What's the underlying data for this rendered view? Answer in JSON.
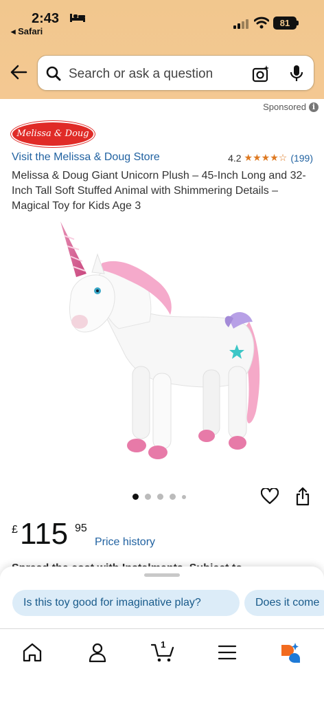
{
  "status_bar": {
    "time": "2:43",
    "back_app": "◂ Safari",
    "battery": "81"
  },
  "search": {
    "placeholder": "Search or ask a question"
  },
  "sponsored": {
    "label": "Sponsored",
    "info": "i"
  },
  "product": {
    "brand_logo_text": "Melissa & Doug",
    "store_link": "Visit the Melissa & Doug Store",
    "rating_value": "4.2",
    "stars": "★★★★☆",
    "rating_count": "(199)",
    "title": "Melissa & Doug Giant Unicorn Plush – 45-Inch Long and 32-Inch Tall Soft Stuffed Animal with Shimmering Details – Magical Toy for Kids Age 3",
    "image_count": 5,
    "active_image": 1
  },
  "price": {
    "currency": "£",
    "whole": "115",
    "fraction": "95",
    "history_link": "Price history"
  },
  "instalments": "Spread the cost with Instalments. Subject to",
  "suggestions": [
    "Is this toy good for imaginative play?",
    "Does it come"
  ],
  "bottom_nav": {
    "cart_count": "1"
  },
  "colors": {
    "header": "#f1c78e",
    "link": "#2162a1",
    "star": "#de7921",
    "chip": "#dcecf8",
    "brand": "#e02b27"
  }
}
